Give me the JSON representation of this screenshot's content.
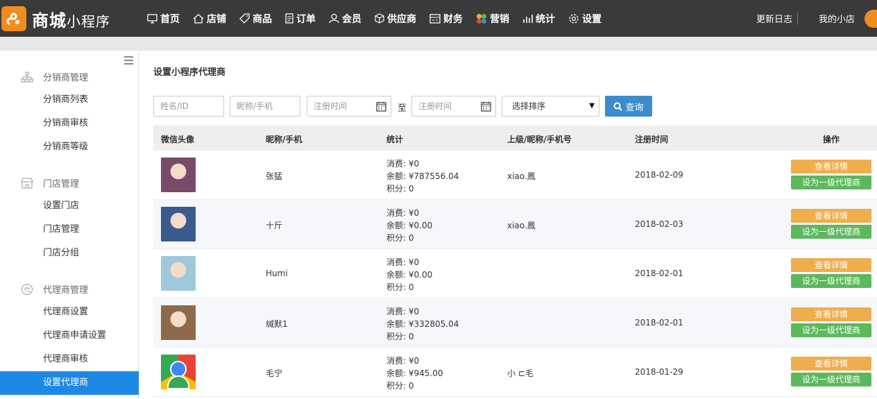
{
  "brand": {
    "name": "商城",
    "sub": "小程序"
  },
  "nav": [
    {
      "icon": "home-screen-icon",
      "label": "首页"
    },
    {
      "icon": "store-icon",
      "label": "店铺"
    },
    {
      "icon": "tag-icon",
      "label": "商品"
    },
    {
      "icon": "order-icon",
      "label": "订单"
    },
    {
      "icon": "user-icon",
      "label": "会员"
    },
    {
      "icon": "box-icon",
      "label": "供应商"
    },
    {
      "icon": "finance-icon",
      "label": "财务"
    },
    {
      "icon": "marketing-icon",
      "label": "营销"
    },
    {
      "icon": "stats-icon",
      "label": "统计"
    },
    {
      "icon": "gear-icon",
      "label": "设置"
    }
  ],
  "top_right": {
    "changelog": "更新日志",
    "my_store": "我的小店"
  },
  "sidebar": {
    "groups": [
      {
        "title": "分销商管理",
        "icon": "org-chart-icon",
        "items": [
          "分销商列表",
          "分销商审核",
          "分销商等级"
        ]
      },
      {
        "title": "门店管理",
        "icon": "shop-icon",
        "items": [
          "设置门店",
          "门店管理",
          "门店分组"
        ]
      },
      {
        "title": "代理商管理",
        "icon": "agent-icon",
        "items": [
          "代理商设置",
          "代理商申请设置",
          "代理商审核",
          "设置代理商"
        ]
      }
    ]
  },
  "page_title": "设置小程序代理商",
  "filters": {
    "name_placeholder": "姓名/ID",
    "nick_placeholder": "昵称/手机",
    "date_from_placeholder": "注册时间",
    "to_label": "至",
    "date_to_placeholder": "注册时间",
    "sort_label": "选择排序",
    "query_label": "查询"
  },
  "table": {
    "headers": [
      "微信头像",
      "昵称/手机",
      "统计",
      "上级/昵称/手机号",
      "注册时间",
      "操作"
    ],
    "rows": [
      {
        "name": "张猛",
        "consume": "消费: ¥0",
        "balance": "余额: ¥787556.04",
        "points": "积分: 0",
        "parent": "xiao.鳳",
        "date": "2018-02-09",
        "avatar_color": "#7a4a6a"
      },
      {
        "name": "十斤",
        "consume": "消费: ¥0",
        "balance": "余额: ¥0.00",
        "points": "积分: 0",
        "parent": "xiao.鳳",
        "date": "2018-02-03",
        "avatar_color": "#3b5b8f"
      },
      {
        "name": "Humi",
        "consume": "消费: ¥0",
        "balance": "余额: ¥0.00",
        "points": "积分: 0",
        "parent": "",
        "date": "2018-02-01",
        "avatar_color": "#9ec8dc"
      },
      {
        "name": "缄默1",
        "consume": "消费: ¥0",
        "balance": "余额: ¥332805.04",
        "points": "积分: 0",
        "parent": "",
        "date": "2018-02-01",
        "avatar_color": "#8c6a4a"
      },
      {
        "name": "毛宁",
        "consume": "消费: ¥0",
        "balance": "余额: ¥945.00",
        "points": "积分: 0",
        "parent": "小 ⊏毛",
        "date": "2018-01-29",
        "avatar_color": "google"
      }
    ],
    "detail_label": "查看详情",
    "set_label": "设为一级代理商"
  }
}
